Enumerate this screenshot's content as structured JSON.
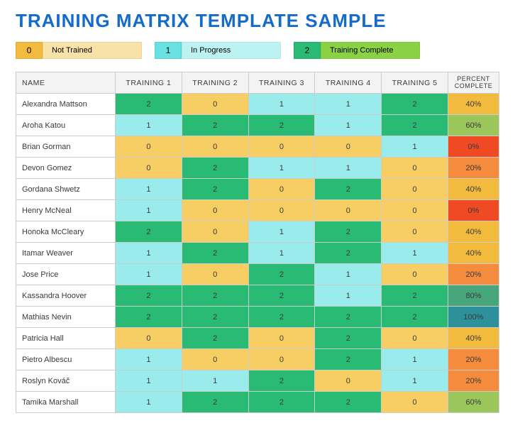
{
  "title": "TRAINING MATRIX TEMPLATE SAMPLE",
  "legend": [
    {
      "value": "0",
      "label": "Not Trained"
    },
    {
      "value": "1",
      "label": "In Progress"
    },
    {
      "value": "2",
      "label": "Training Complete"
    }
  ],
  "columns": {
    "name": "NAME",
    "trainings": [
      "TRAINING 1",
      "TRAINING 2",
      "TRAINING 3",
      "TRAINING 4",
      "TRAINING 5"
    ],
    "percent": "PERCENT COMPLETE"
  },
  "pctColors": {
    "0": "#F04A24",
    "20": "#F58B3C",
    "40": "#F3BB3D",
    "60": "#9BC65B",
    "80": "#47A77B",
    "100": "#2C919B"
  },
  "rows": [
    {
      "name": "Alexandra Mattson",
      "t": [
        2,
        0,
        1,
        1,
        2
      ],
      "pct": "40%"
    },
    {
      "name": "Aroha Katou",
      "t": [
        1,
        2,
        2,
        1,
        2
      ],
      "pct": "60%"
    },
    {
      "name": "Brian Gorman",
      "t": [
        0,
        0,
        0,
        0,
        1
      ],
      "pct": "0%"
    },
    {
      "name": "Devon Gomez",
      "t": [
        0,
        2,
        1,
        1,
        0
      ],
      "pct": "20%"
    },
    {
      "name": "Gordana Shwetz",
      "t": [
        1,
        2,
        0,
        2,
        0
      ],
      "pct": "40%"
    },
    {
      "name": "Henry McNeal",
      "t": [
        1,
        0,
        0,
        0,
        0
      ],
      "pct": "0%"
    },
    {
      "name": "Honoka McCleary",
      "t": [
        2,
        0,
        1,
        2,
        0
      ],
      "pct": "40%"
    },
    {
      "name": "Itamar Weaver",
      "t": [
        1,
        2,
        1,
        2,
        1
      ],
      "pct": "40%"
    },
    {
      "name": "Jose Price",
      "t": [
        1,
        0,
        2,
        1,
        0
      ],
      "pct": "20%"
    },
    {
      "name": "Kassandra Hoover",
      "t": [
        2,
        2,
        2,
        1,
        2
      ],
      "pct": "80%"
    },
    {
      "name": "Mathias Nevin",
      "t": [
        2,
        2,
        2,
        2,
        2
      ],
      "pct": "100%"
    },
    {
      "name": "Patricia Hall",
      "t": [
        0,
        2,
        0,
        2,
        0
      ],
      "pct": "40%"
    },
    {
      "name": "Pietro Albescu",
      "t": [
        1,
        0,
        0,
        2,
        1
      ],
      "pct": "20%"
    },
    {
      "name": "Roslyn Kováč",
      "t": [
        1,
        1,
        2,
        0,
        1
      ],
      "pct": "20%"
    },
    {
      "name": "Tamika Marshall",
      "t": [
        1,
        2,
        2,
        2,
        0
      ],
      "pct": "60%"
    }
  ]
}
